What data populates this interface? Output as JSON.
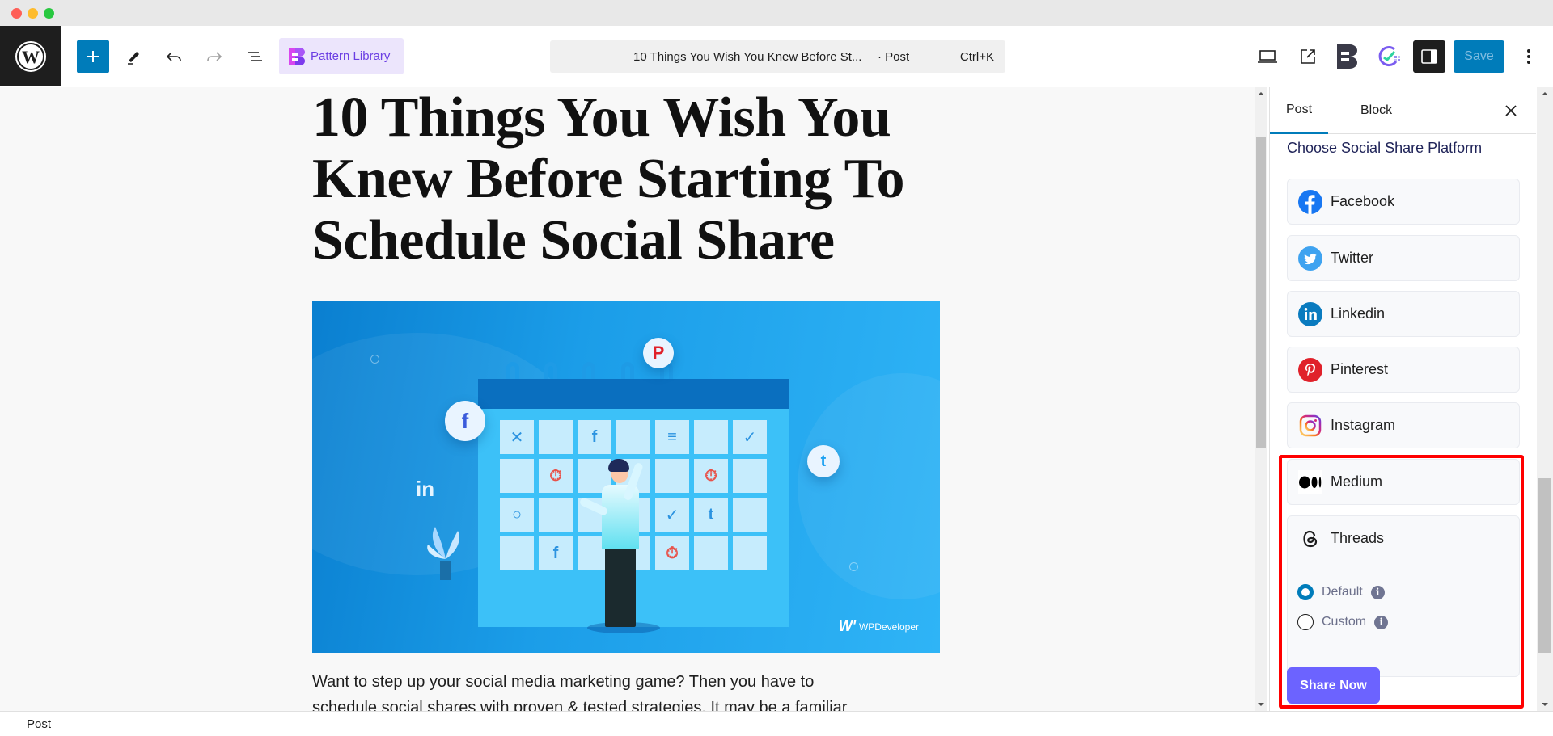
{
  "window": {
    "controls": [
      "close",
      "minimize",
      "maximize"
    ]
  },
  "toolbar": {
    "logo_icon": "wordpress-logo-icon",
    "add_block_icon": "plus-icon",
    "tools_icon": "pen-icon",
    "undo_icon": "undo-icon",
    "redo_icon": "redo-icon",
    "document_overview_icon": "list-view-icon",
    "pattern_library_label": "Pattern Library",
    "command_bar": {
      "title": "10 Things You Wish You Knew Before St...",
      "post_type": "· Post",
      "shortcut": "Ctrl+K"
    },
    "view_icon": "laptop-icon",
    "preview_icon": "external-link-icon",
    "plugin_icon_1": "betterdocs-icon",
    "plugin_icon_2": "schedulepress-icon",
    "settings_icon": "sidebar-toggle-icon",
    "save_label": "Save",
    "options_icon": "vertical-ellipsis-icon"
  },
  "editor": {
    "post_title": "10 Things You Wish You Knew Before Starting To Schedule Social Share",
    "featured_image": {
      "alt": "Person scheduling social media posts on a calendar",
      "brand": "WPDeveloper",
      "social_icons": [
        "facebook",
        "pinterest",
        "twitter",
        "linkedin"
      ]
    },
    "body_lines": [
      "Want to step up your social media marketing game? Then you have to",
      "schedule social shares with proven & tested strategies. It may be a familiar"
    ]
  },
  "sidebar": {
    "tabs": [
      {
        "label": "Post",
        "active": true
      },
      {
        "label": "Block",
        "active": false
      }
    ],
    "close_icon": "close-icon",
    "heading": "Choose Social Share Platform",
    "platforms": [
      {
        "label": "Facebook",
        "icon": "facebook-icon",
        "color": "#1877f2"
      },
      {
        "label": "Twitter",
        "icon": "twitter-icon",
        "color": "#3fa3f0"
      },
      {
        "label": "Linkedin",
        "icon": "linkedin-icon",
        "color": "#0a7bbf"
      },
      {
        "label": "Pinterest",
        "icon": "pinterest-icon",
        "color": "#e0212a"
      },
      {
        "label": "Instagram",
        "icon": "instagram-icon",
        "color": "#d62976"
      },
      {
        "label": "Medium",
        "icon": "medium-icon",
        "color": "#000000"
      },
      {
        "label": "Threads",
        "icon": "threads-icon",
        "color": "#000000"
      }
    ],
    "threads_options": [
      {
        "label": "Default",
        "checked": true
      },
      {
        "label": "Custom",
        "checked": false
      }
    ],
    "share_button_label": "Share Now"
  },
  "footer": {
    "breadcrumb": "Post"
  },
  "colors": {
    "wp_blue": "#007cba",
    "share_button": "#6c63ff",
    "highlight": "#ff0000",
    "heading": "#1f2358"
  }
}
